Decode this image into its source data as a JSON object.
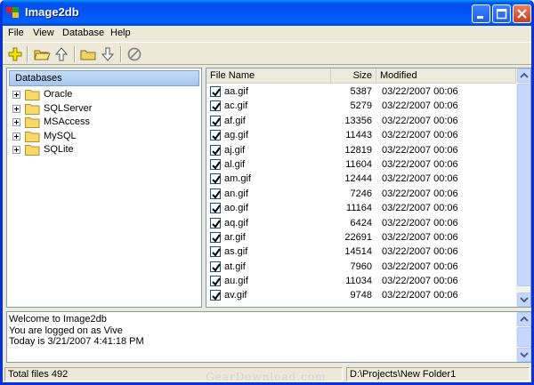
{
  "window": {
    "title": "Image2db"
  },
  "menu": [
    "File",
    "View",
    "Database",
    "Help"
  ],
  "toolbar": [
    "add-icon",
    "open-folder-icon",
    "up-arrow-icon",
    "folder-icon",
    "down-arrow-icon",
    "cancel-icon"
  ],
  "databases": {
    "header": "Databases",
    "items": [
      {
        "label": "Oracle"
      },
      {
        "label": "SQLServer"
      },
      {
        "label": "MSAccess"
      },
      {
        "label": "MySQL"
      },
      {
        "label": "SQLite"
      }
    ]
  },
  "files": {
    "columns": {
      "name": "File Name",
      "size": "Size",
      "modified": "Modified"
    },
    "rows": [
      {
        "name": "aa.gif",
        "size": "5387",
        "modified": "03/22/2007  00:06"
      },
      {
        "name": "ac.gif",
        "size": "5279",
        "modified": "03/22/2007  00:06"
      },
      {
        "name": "af.gif",
        "size": "13356",
        "modified": "03/22/2007  00:06"
      },
      {
        "name": "ag.gif",
        "size": "11443",
        "modified": "03/22/2007  00:06"
      },
      {
        "name": "aj.gif",
        "size": "12819",
        "modified": "03/22/2007  00:06"
      },
      {
        "name": "al.gif",
        "size": "11604",
        "modified": "03/22/2007  00:06"
      },
      {
        "name": "am.gif",
        "size": "12444",
        "modified": "03/22/2007  00:06"
      },
      {
        "name": "an.gif",
        "size": "7246",
        "modified": "03/22/2007  00:06"
      },
      {
        "name": "ao.gif",
        "size": "11164",
        "modified": "03/22/2007  00:06"
      },
      {
        "name": "aq.gif",
        "size": "6424",
        "modified": "03/22/2007  00:06"
      },
      {
        "name": "ar.gif",
        "size": "22691",
        "modified": "03/22/2007  00:06"
      },
      {
        "name": "as.gif",
        "size": "14514",
        "modified": "03/22/2007  00:06"
      },
      {
        "name": "at.gif",
        "size": "7960",
        "modified": "03/22/2007  00:06"
      },
      {
        "name": "au.gif",
        "size": "11034",
        "modified": "03/22/2007  00:06"
      },
      {
        "name": "av.gif",
        "size": "9748",
        "modified": "03/22/2007  00:06"
      }
    ]
  },
  "log": {
    "lines": [
      "Welcome to Image2db",
      "You are logged on as Vive",
      "Today is 3/21/2007 4:41:18 PM"
    ]
  },
  "status": {
    "total": "Total files 492",
    "path": "D:\\Projects\\New Folder1"
  },
  "watermark": "GearDownload.com"
}
